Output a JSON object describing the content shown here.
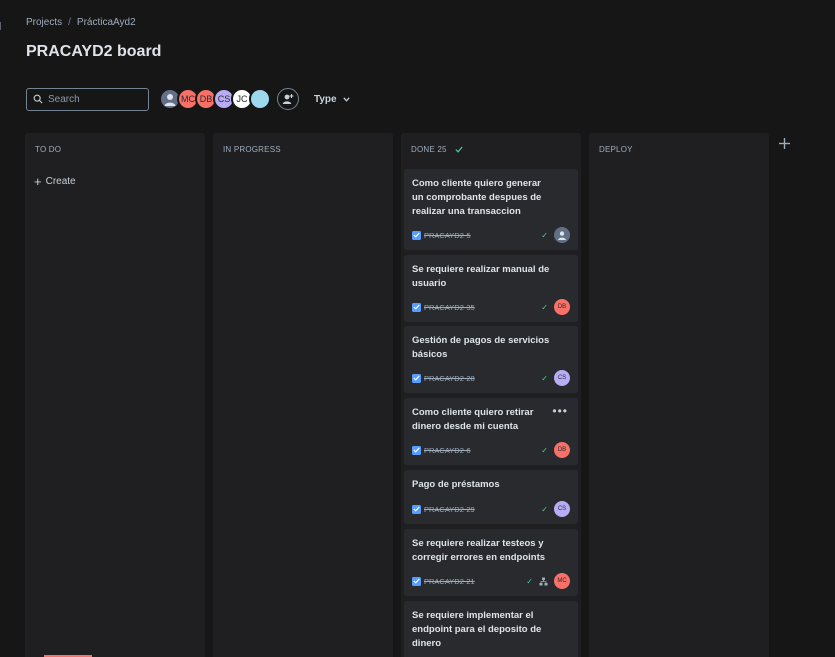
{
  "breadcrumb": {
    "projects": "Projects",
    "separator": "/",
    "project": "PrácticaAyd2"
  },
  "page_title": "PRACAYD2 board",
  "search": {
    "placeholder": "Search"
  },
  "avatars": [
    {
      "initials": "",
      "color": "#626f86"
    },
    {
      "initials": "MC",
      "color": "#f87168"
    },
    {
      "initials": "DB",
      "color": "#f87168"
    },
    {
      "initials": "CS",
      "color": "#b8acf6"
    },
    {
      "initials": "JC",
      "color": "#ffffff"
    },
    {
      "initials": "JC",
      "color": "#9dd9ee"
    }
  ],
  "type_filter": "Type",
  "columns": {
    "todo": {
      "title": "TO DO",
      "create": "Create"
    },
    "inprogress": {
      "title": "IN PROGRESS"
    },
    "done": {
      "title": "DONE 25"
    },
    "deploy": {
      "title": "DEPLOY"
    }
  },
  "cards": [
    {
      "title": "Como cliente quiero generar un comprobante despues de realizar una transaccion",
      "key": "PRACAYD2-5",
      "assignee": "",
      "assignee_color": "#626f86"
    },
    {
      "title": "Se requiere realizar manual de usuario",
      "key": "PRACAYD2-35",
      "assignee": "DB",
      "assignee_color": "#f87168"
    },
    {
      "title": "Gestión de pagos de servicios básicos",
      "key": "PRACAYD2-28",
      "assignee": "CS",
      "assignee_color": "#b8acf6"
    },
    {
      "title": "Como cliente quiero retirar dinero desde mi cuenta",
      "key": "PRACAYD2-6",
      "assignee": "DB",
      "assignee_color": "#f87168"
    },
    {
      "title": "Pago de préstamos",
      "key": "PRACAYD2-29",
      "assignee": "CS",
      "assignee_color": "#b8acf6"
    },
    {
      "title": "Se requiere realizar testeos y corregir errores en endpoints",
      "key": "PRACAYD2-21",
      "assignee": "MC",
      "assignee_color": "#f87168"
    },
    {
      "title": "Se requiere implementar el endpoint para el deposito de dinero",
      "key": "",
      "assignee": "",
      "assignee_color": ""
    }
  ],
  "colors": {
    "background": "#161616",
    "column": "#1f1f21",
    "card": "#282a2d",
    "done_check": "#4bce97",
    "checkbox": "#579dff"
  }
}
